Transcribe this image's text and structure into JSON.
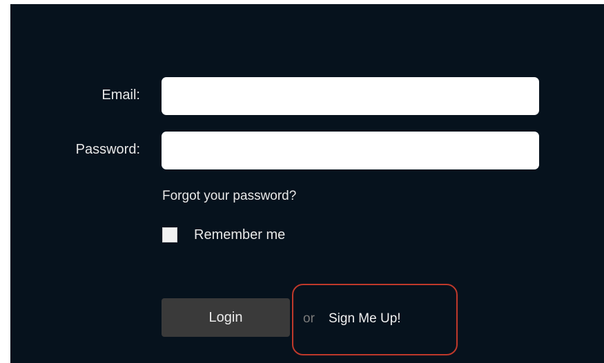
{
  "form": {
    "email_label": "Email:",
    "email_value": "",
    "password_label": "Password:",
    "password_value": "",
    "forgot_link": "Forgot your password?",
    "remember_label": "Remember me",
    "remember_checked": false,
    "login_label": "Login",
    "or_text": "or",
    "signup_label": "Sign Me Up!"
  },
  "colors": {
    "background": "#06121d",
    "field": "#ffffff",
    "text": "#e8e8e8",
    "button": "#3a3a3a",
    "highlight": "#c0392b"
  }
}
